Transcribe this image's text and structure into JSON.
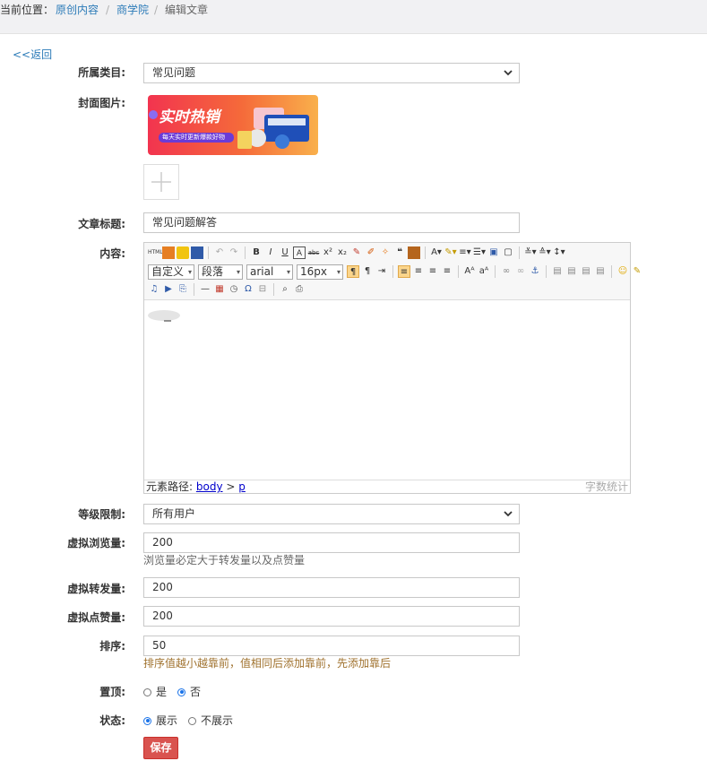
{
  "breadcrumb": {
    "prefix": "当前位置：",
    "items": [
      "原创内容",
      "商学院"
    ],
    "current": "编辑文章",
    "separator": "/"
  },
  "back_label": "<<返回",
  "form": {
    "category": {
      "label": "所属类目:",
      "value": "常见问题"
    },
    "cover": {
      "label": "封面图片:",
      "banner_title": "实时热销",
      "banner_subtitle": "每天实时更新爆款好物"
    },
    "title": {
      "label": "文章标题:",
      "value": "常见问题解答"
    },
    "content": {
      "label": "内容:",
      "combos": {
        "style": "自定义",
        "paragraph": "段落",
        "font": "arial",
        "size": "16px"
      },
      "status_prefix": "元素路径:",
      "path_body": "body",
      "path_sep": ">",
      "path_p": "p",
      "word_count": "字数统计"
    },
    "level": {
      "label": "等级限制:",
      "value": "所有用户"
    },
    "views": {
      "label": "虚拟浏览量:",
      "value": "200",
      "hint": "浏览量必定大于转发量以及点赞量"
    },
    "shares": {
      "label": "虚拟转发量:",
      "value": "200"
    },
    "likes": {
      "label": "虚拟点赞量:",
      "value": "200"
    },
    "sort": {
      "label": "排序:",
      "value": "50",
      "hint": "排序值越小越靠前，值相同后添加靠前，先添加靠后"
    },
    "top": {
      "label": "置顶:",
      "options": [
        "是",
        "否"
      ],
      "selected": 1
    },
    "status": {
      "label": "状态:",
      "options": [
        "展示",
        "不展示"
      ],
      "selected": 0
    },
    "save_label": "保存"
  },
  "colors": {
    "link": "#2c7bb8",
    "save": "#d9534f",
    "hint_brown": "#a0722e",
    "radio": "#1a73e8"
  }
}
